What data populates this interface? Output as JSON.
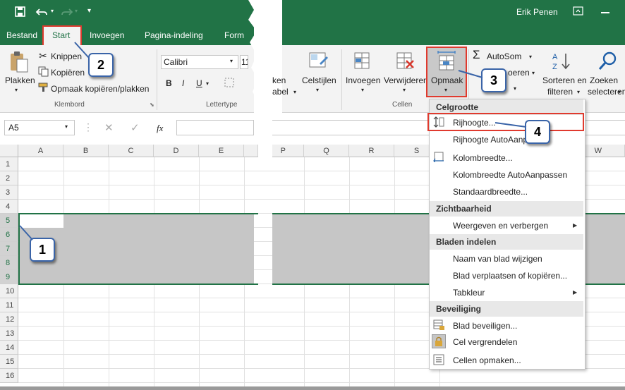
{
  "titlebar": {
    "user": "Erik Penen"
  },
  "tabs": [
    "Bestand",
    "Start",
    "Invoegen",
    "Pagina-indeling",
    "Form"
  ],
  "ribbon": {
    "clipboard": {
      "paste": "Plakken",
      "cut": "Knippen",
      "copy": "Kopiëren",
      "format_painter": "Opmaak kopiëren/plakken",
      "group": "Klembord"
    },
    "font": {
      "name": "Calibri",
      "size": "11",
      "group": "Lettertype",
      "bold": "B",
      "italic": "I",
      "underline": "U"
    },
    "styles": {
      "table_partial": "ken",
      "table_partial2": "abel",
      "cell_styles": "Celstijlen"
    },
    "cells": {
      "insert": "Invoegen",
      "delete": "Verwijderen",
      "format": "Opmaak",
      "group": "Cellen"
    },
    "editing": {
      "autosum": "AutoSom",
      "fill_partial": "oeren",
      "sort": "Sorteren en",
      "sort2": "filteren",
      "find": "Zoeken",
      "find2": "selecteren"
    }
  },
  "formula": {
    "namebox": "A5",
    "fx": "fx"
  },
  "columns_left": [
    "A",
    "B",
    "C",
    "D",
    "E"
  ],
  "columns_right": [
    "P",
    "Q",
    "R",
    "S",
    "W"
  ],
  "rows": [
    "1",
    "2",
    "3",
    "4",
    "5",
    "6",
    "7",
    "8",
    "9",
    "10",
    "11",
    "12",
    "13",
    "14",
    "15",
    "16"
  ],
  "menu": {
    "h1": "Celgrootte",
    "row_height": "Rijhoogte...",
    "row_height_auto": "Rijhoogte AutoAanpassen",
    "col_width": "Kolombreedte...",
    "col_width_auto": "Kolombreedte AutoAanpassen",
    "std_width": "Standaardbreedte...",
    "h2": "Zichtbaarheid",
    "show_hide": "Weergeven en verbergen",
    "h3": "Bladen indelen",
    "rename": "Naam van blad wijzigen",
    "move": "Blad verplaatsen of kopiëren...",
    "tab_color": "Tabkleur",
    "h4": "Beveiliging",
    "protect": "Blad beveiligen...",
    "lock": "Cel vergrendelen",
    "format_cells": "Cellen opmaken..."
  },
  "callouts": [
    "1",
    "2",
    "3",
    "4"
  ]
}
